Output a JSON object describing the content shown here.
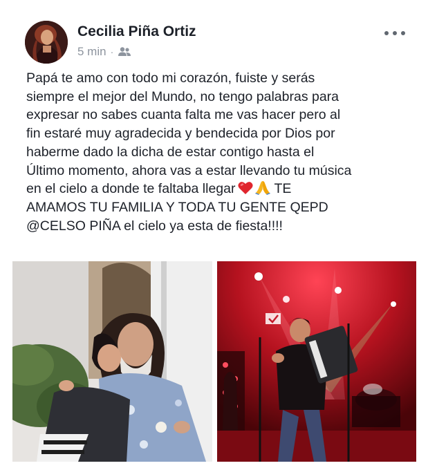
{
  "post": {
    "author": "Cecilia Piña Ortiz",
    "time": "5 min",
    "separator": "·",
    "audience_icon": "friends-icon",
    "more_icon": "more-options-icon",
    "lines": [
      "Papá te amo con todo mi corazón, fuiste y serás",
      "siempre el mejor del Mundo, no tengo palabras para",
      "expresar no sabes cuanta falta me vas hacer pero al",
      "fin estaré muy agradecida y bendecida por Dios   por",
      "haberme dado la dicha de estar contigo hasta el",
      "Último momento, ahora vas a estar llevando tu música",
      "en el cielo a donde te faltaba llegar",
      "TE",
      "AMAMOS TU FAMILIA  Y TODA TU  GENTE QEPD",
      "@CELSO PIÑA el cielo ya esta de fiesta!!!!"
    ],
    "emojis": [
      "red-heart-emoji",
      "folded-hands-emoji"
    ]
  },
  "colors": {
    "text": "#1d2129",
    "meta": "#8d949e",
    "icon": "#606770",
    "stage_red": "#c41a2a"
  }
}
